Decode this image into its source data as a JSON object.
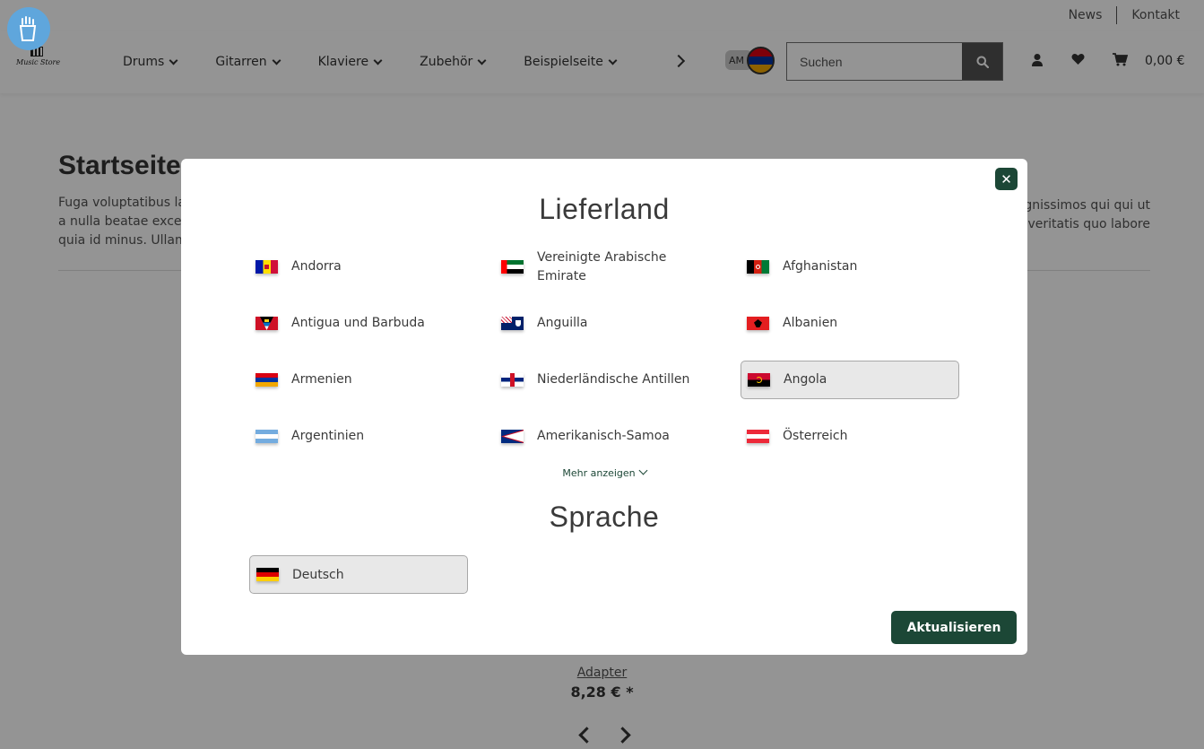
{
  "topbar": {
    "news": "News",
    "contact": "Kontakt"
  },
  "logo": {
    "text": "Music Store"
  },
  "nav": {
    "items": [
      {
        "label": "Drums"
      },
      {
        "label": "Gitarren"
      },
      {
        "label": "Klaviere"
      },
      {
        "label": "Zubehör"
      },
      {
        "label": "Beispielseite"
      }
    ]
  },
  "language_badge": {
    "code": "AM"
  },
  "search": {
    "placeholder": "Suchen"
  },
  "cart": {
    "total": "0,00 €"
  },
  "content": {
    "title": "Startseite",
    "text_line1": "Fuga voluptatibus lab",
    "text_line2": "a nulla beatae except",
    "text_line3": "quia id minus. Ullam",
    "text_right1": "dignissimos qui qui ut",
    "text_right2": "veritatis quo labore"
  },
  "product": {
    "name": "Adapter",
    "price": "8,28 € *"
  },
  "modal": {
    "title_country": "Lieferland",
    "countries": [
      {
        "name": "Andorra",
        "flag": "andorra"
      },
      {
        "name": "Vereinigte Arabische Emirate",
        "flag": "uae"
      },
      {
        "name": "Afghanistan",
        "flag": "afghanistan"
      },
      {
        "name": "Antigua und Barbuda",
        "flag": "antigua"
      },
      {
        "name": "Anguilla",
        "flag": "anguilla"
      },
      {
        "name": "Albanien",
        "flag": "albania"
      },
      {
        "name": "Armenien",
        "flag": "armenia"
      },
      {
        "name": "Niederländische Antillen",
        "flag": "netherlands-antilles"
      },
      {
        "name": "Angola",
        "flag": "angola",
        "selected": true
      },
      {
        "name": "Argentinien",
        "flag": "argentina"
      },
      {
        "name": "Amerikanisch-Samoa",
        "flag": "american-samoa"
      },
      {
        "name": "Österreich",
        "flag": "austria"
      }
    ],
    "more_label": "Mehr anzeigen",
    "title_language": "Sprache",
    "language": {
      "name": "Deutsch",
      "flag": "germany"
    },
    "update_label": "Aktualisieren",
    "close_icon": "close-icon"
  },
  "colors": {
    "primary": "#1c4736",
    "fab": "#5fa6dc"
  }
}
